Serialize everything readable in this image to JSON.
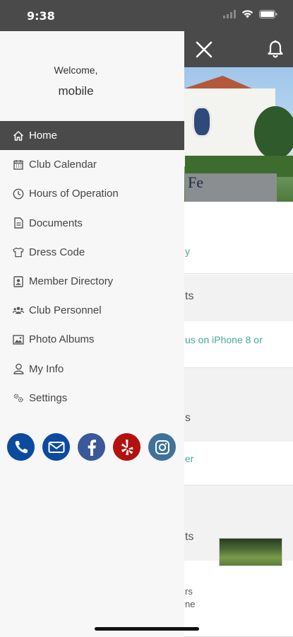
{
  "status_bar": {
    "time": "9:38"
  },
  "drawer": {
    "welcome": "Welcome,",
    "username": "mobile",
    "menu": [
      {
        "label": "Home",
        "icon": "home-icon",
        "active": true
      },
      {
        "label": "Club Calendar",
        "icon": "calendar-icon",
        "active": false
      },
      {
        "label": "Hours of Operation",
        "icon": "clock-icon",
        "active": false
      },
      {
        "label": "Documents",
        "icon": "document-icon",
        "active": false
      },
      {
        "label": "Dress Code",
        "icon": "shirt-icon",
        "active": false
      },
      {
        "label": "Member Directory",
        "icon": "directory-icon",
        "active": false
      },
      {
        "label": "Club Personnel",
        "icon": "people-icon",
        "active": false
      },
      {
        "label": "Photo Albums",
        "icon": "photo-icon",
        "active": false
      },
      {
        "label": "My Info",
        "icon": "user-icon",
        "active": false
      },
      {
        "label": "Settings",
        "icon": "gears-icon",
        "active": false
      }
    ],
    "socials": [
      {
        "name": "phone-icon",
        "color": "#0c4aa0"
      },
      {
        "name": "email-icon",
        "color": "#0c4aa0"
      },
      {
        "name": "facebook-icon",
        "color": "#3b5998"
      },
      {
        "name": "yelp-icon",
        "color": "#b2110e"
      },
      {
        "name": "instagram-icon",
        "color": "#3f729b"
      }
    ]
  },
  "background": {
    "hero_sign": "Fe",
    "link_1": "y",
    "section_1": "ts",
    "link_2": "us on iPhone 8 or",
    "section_2": "s",
    "link_3": "er",
    "section_3": "ts",
    "news_line_1": "rs",
    "news_line_2": "ne"
  },
  "colors": {
    "header": "#4a4a4a",
    "accent_link": "#4aa89a",
    "drawer_bg": "#f7f7f7"
  }
}
